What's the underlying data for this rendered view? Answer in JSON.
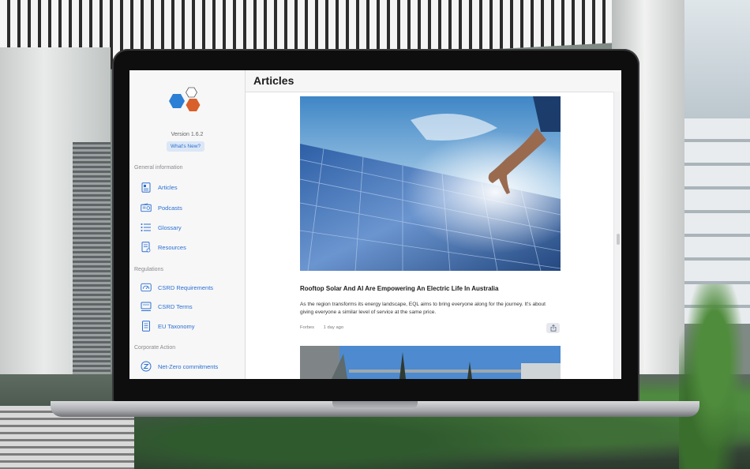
{
  "sidebar": {
    "version": "Version 1.6.2",
    "whats_new": "What's New?",
    "sections": [
      {
        "header": "General information",
        "items": [
          {
            "label": "Articles",
            "icon": "article-icon"
          },
          {
            "label": "Podcasts",
            "icon": "radio-icon"
          },
          {
            "label": "Glossary",
            "icon": "list-icon"
          },
          {
            "label": "Resources",
            "icon": "document-icon"
          }
        ]
      },
      {
        "header": "Regulations",
        "items": [
          {
            "label": "CSRD Requirements",
            "icon": "gauge-icon"
          },
          {
            "label": "CSRD Terms",
            "icon": "monitor-icon"
          },
          {
            "label": "EU Taxonomy",
            "icon": "book-icon"
          }
        ]
      },
      {
        "header": "Corporate Action",
        "items": [
          {
            "label": "Net-Zero commitments",
            "icon": "z-circle-icon"
          }
        ]
      }
    ],
    "colors": {
      "accent": "#2a6fd1",
      "logo_blue": "#2b7fd4",
      "logo_orange": "#d9602b"
    }
  },
  "main": {
    "title": "Articles",
    "article": {
      "title": "Rooftop Solar And AI Are Empowering An Electric Life In Australia",
      "description": "As the region transforms its energy landscape, EQL aims to bring everyone along for the journey. It's about giving everyone a similar level of service at the same price.",
      "source": "Forbes",
      "time": "1 day ago",
      "share_icon": "share-icon"
    }
  }
}
